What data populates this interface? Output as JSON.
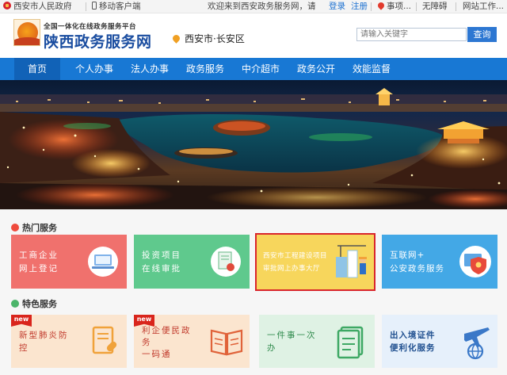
{
  "topbar": {
    "gov_link": "西安市人民政府",
    "mobile_link": "移动客户端",
    "welcome": "欢迎来到西安政务服务网，请",
    "login": "登录",
    "register": "注册",
    "feedback": "事项...",
    "accessibility": "无障碍",
    "site_tools": "网站工作..."
  },
  "header": {
    "slogan": "全国一体化在线政务服务平台",
    "site_name": "陕西政务服务网",
    "location": "西安市·长安区",
    "search_placeholder": "请输入关键字",
    "search_button": "查询"
  },
  "nav": {
    "items": [
      {
        "label": "首页",
        "active": true
      },
      {
        "label": "个人办事",
        "active": false
      },
      {
        "label": "法人办事",
        "active": false
      },
      {
        "label": "政务服务",
        "active": false
      },
      {
        "label": "中介超市",
        "active": false
      },
      {
        "label": "政务公开",
        "active": false
      },
      {
        "label": "效能监督",
        "active": false
      }
    ]
  },
  "hot": {
    "title": "热门服务",
    "cards": [
      {
        "line1": "工商企业",
        "line2": "网上登记",
        "color": "#f0716d"
      },
      {
        "line1": "投资项目",
        "line2": "在线审批",
        "color": "#5fc98d"
      },
      {
        "line1": "西安市工程建设项目",
        "line2": "审批网上办事大厅",
        "color": "#f7d65c"
      },
      {
        "line1": "互联网+",
        "line2": "公安政务服务",
        "color": "#43a8e6"
      }
    ]
  },
  "featured": {
    "title": "特色服务",
    "cards": [
      {
        "line1": "新型肺炎防",
        "line2": "控",
        "tag": "new",
        "color": "#fbe5cf"
      },
      {
        "line1": "利企便民政",
        "line2": "务",
        "line3": "一码通",
        "tag": "new",
        "color": "#fbe5cf"
      },
      {
        "line1": "一件事一次",
        "line2": "办",
        "color": "#dff2e4"
      },
      {
        "line1": "出入境证件",
        "line2": "便利化服务",
        "color": "#e6f0fb"
      }
    ]
  },
  "colors": {
    "nav_blue": "#1878d4",
    "nav_active": "#1162b7",
    "highlight_border": "#d9252b",
    "brand_blue": "#1a4da0"
  }
}
